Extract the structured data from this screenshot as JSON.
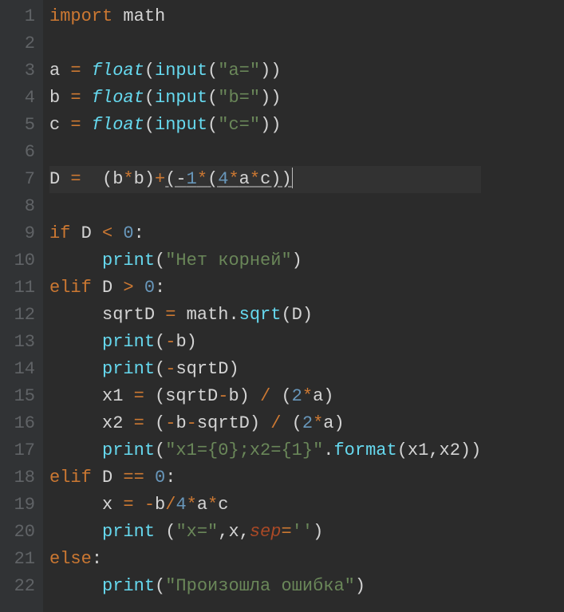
{
  "lineCount": 22,
  "tokens": {
    "l1": [
      [
        "kw",
        "import"
      ],
      [
        "punc",
        " math"
      ]
    ],
    "l2": [],
    "l3": [
      [
        "punc",
        "a "
      ],
      [
        "op",
        "="
      ],
      [
        "punc",
        " "
      ],
      [
        "fn",
        "float"
      ],
      [
        "punc",
        "("
      ],
      [
        "call",
        "input"
      ],
      [
        "punc",
        "("
      ],
      [
        "str",
        "\"a=\""
      ],
      [
        "punc",
        "))"
      ]
    ],
    "l4": [
      [
        "punc",
        "b "
      ],
      [
        "op",
        "="
      ],
      [
        "punc",
        " "
      ],
      [
        "fn",
        "float"
      ],
      [
        "punc",
        "("
      ],
      [
        "call",
        "input"
      ],
      [
        "punc",
        "("
      ],
      [
        "str",
        "\"b=\""
      ],
      [
        "punc",
        "))"
      ]
    ],
    "l5": [
      [
        "punc",
        "c "
      ],
      [
        "op",
        "="
      ],
      [
        "punc",
        " "
      ],
      [
        "fn",
        "float"
      ],
      [
        "punc",
        "("
      ],
      [
        "call",
        "input"
      ],
      [
        "punc",
        "("
      ],
      [
        "str",
        "\"c=\""
      ],
      [
        "punc",
        "))"
      ]
    ],
    "l6": [],
    "l7": [
      [
        "punc",
        "D "
      ],
      [
        "op",
        "="
      ],
      [
        "punc",
        "  (b"
      ],
      [
        "op",
        "*"
      ],
      [
        "punc",
        "b)"
      ],
      [
        "op",
        "+"
      ],
      [
        "underline",
        "(-"
      ],
      [
        "num underline",
        "1"
      ],
      [
        "op underline",
        "*"
      ],
      [
        "underline",
        "("
      ],
      [
        "num underline",
        "4"
      ],
      [
        "op underline",
        "*"
      ],
      [
        "underline",
        "a"
      ],
      [
        "op underline",
        "*"
      ],
      [
        "underline",
        "c))"
      ]
    ],
    "l8": [],
    "l9": [
      [
        "kw",
        "if"
      ],
      [
        "punc",
        " D "
      ],
      [
        "op",
        "<"
      ],
      [
        "punc",
        " "
      ],
      [
        "num",
        "0"
      ],
      [
        "punc",
        ":"
      ]
    ],
    "l10": [
      [
        "punc",
        "     "
      ],
      [
        "call",
        "print"
      ],
      [
        "punc",
        "("
      ],
      [
        "str",
        "\"Нет корней\""
      ],
      [
        "punc",
        ")"
      ]
    ],
    "l11": [
      [
        "kw",
        "elif"
      ],
      [
        "punc",
        " D "
      ],
      [
        "op",
        ">"
      ],
      [
        "punc",
        " "
      ],
      [
        "num",
        "0"
      ],
      [
        "punc",
        ":"
      ]
    ],
    "l12": [
      [
        "punc",
        "     sqrtD "
      ],
      [
        "op",
        "="
      ],
      [
        "punc",
        " math."
      ],
      [
        "call",
        "sqrt"
      ],
      [
        "punc",
        "(D)"
      ]
    ],
    "l13": [
      [
        "punc",
        "     "
      ],
      [
        "call",
        "print"
      ],
      [
        "punc",
        "("
      ],
      [
        "op",
        "-"
      ],
      [
        "punc",
        "b)"
      ]
    ],
    "l14": [
      [
        "punc",
        "     "
      ],
      [
        "call",
        "print"
      ],
      [
        "punc",
        "("
      ],
      [
        "op",
        "-"
      ],
      [
        "punc",
        "sqrtD)"
      ]
    ],
    "l15": [
      [
        "punc",
        "     x1 "
      ],
      [
        "op",
        "="
      ],
      [
        "punc",
        " (sqrtD"
      ],
      [
        "op",
        "-"
      ],
      [
        "punc",
        "b) "
      ],
      [
        "op",
        "/"
      ],
      [
        "punc",
        " ("
      ],
      [
        "num",
        "2"
      ],
      [
        "op",
        "*"
      ],
      [
        "punc",
        "a)"
      ]
    ],
    "l16": [
      [
        "punc",
        "     x2 "
      ],
      [
        "op",
        "="
      ],
      [
        "punc",
        " ("
      ],
      [
        "op",
        "-"
      ],
      [
        "punc",
        "b"
      ],
      [
        "op",
        "-"
      ],
      [
        "punc",
        "sqrtD) "
      ],
      [
        "op",
        "/"
      ],
      [
        "punc",
        " ("
      ],
      [
        "num",
        "2"
      ],
      [
        "op",
        "*"
      ],
      [
        "punc",
        "a)"
      ]
    ],
    "l17": [
      [
        "punc",
        "     "
      ],
      [
        "call",
        "print"
      ],
      [
        "punc",
        "("
      ],
      [
        "str",
        "\"x1={0};x2={1}\""
      ],
      [
        "punc",
        "."
      ],
      [
        "call",
        "format"
      ],
      [
        "punc",
        "(x1,x2))"
      ]
    ],
    "l18": [
      [
        "kw",
        "elif"
      ],
      [
        "punc",
        " D "
      ],
      [
        "op",
        "=="
      ],
      [
        "punc",
        " "
      ],
      [
        "num",
        "0"
      ],
      [
        "punc",
        ":"
      ]
    ],
    "l19": [
      [
        "punc",
        "     x "
      ],
      [
        "op",
        "="
      ],
      [
        "punc",
        " "
      ],
      [
        "op",
        "-"
      ],
      [
        "punc",
        "b"
      ],
      [
        "op",
        "/"
      ],
      [
        "num",
        "4"
      ],
      [
        "op",
        "*"
      ],
      [
        "punc",
        "a"
      ],
      [
        "op",
        "*"
      ],
      [
        "punc",
        "c"
      ]
    ],
    "l20": [
      [
        "punc",
        "     "
      ],
      [
        "call",
        "print"
      ],
      [
        "punc",
        " ("
      ],
      [
        "str",
        "\"x=\""
      ],
      [
        "punc",
        ",x,"
      ],
      [
        "named",
        "sep"
      ],
      [
        "op",
        "="
      ],
      [
        "str",
        "''"
      ],
      [
        "punc",
        ")"
      ]
    ],
    "l21": [
      [
        "kw",
        "else"
      ],
      [
        "punc",
        ":"
      ]
    ],
    "l22": [
      [
        "punc",
        "     "
      ],
      [
        "call",
        "print"
      ],
      [
        "punc",
        "("
      ],
      [
        "str",
        "\"Произошла ошибка\""
      ],
      [
        "punc",
        ")"
      ]
    ]
  },
  "currentLine": 7,
  "cursorLine": 7
}
